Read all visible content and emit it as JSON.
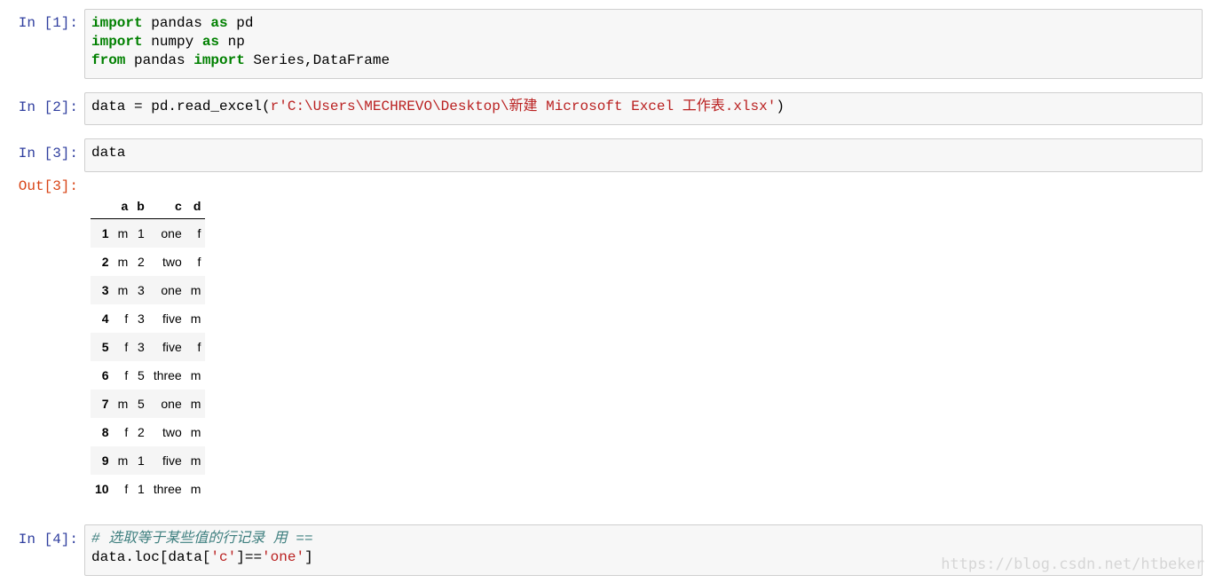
{
  "cells": {
    "c1": {
      "prompt": "In [1]:",
      "lines": [
        [
          {
            "t": "import",
            "c": "kw"
          },
          {
            "t": " pandas ",
            "c": "op"
          },
          {
            "t": "as",
            "c": "kw"
          },
          {
            "t": " pd",
            "c": "op"
          }
        ],
        [
          {
            "t": "import",
            "c": "kw"
          },
          {
            "t": " numpy ",
            "c": "op"
          },
          {
            "t": "as",
            "c": "kw"
          },
          {
            "t": " np",
            "c": "op"
          }
        ],
        [
          {
            "t": "from",
            "c": "kw"
          },
          {
            "t": " pandas ",
            "c": "op"
          },
          {
            "t": "import",
            "c": "kw"
          },
          {
            "t": " Series,DataFrame",
            "c": "op"
          }
        ]
      ]
    },
    "c2": {
      "prompt": "In [2]:",
      "lines": [
        [
          {
            "t": "data = pd.read_excel(",
            "c": "op"
          },
          {
            "t": "r'C:\\Users\\MECHREVO\\Desktop\\新建 Microsoft Excel 工作表.xlsx'",
            "c": "str"
          },
          {
            "t": ")",
            "c": "op"
          }
        ]
      ]
    },
    "c3": {
      "prompt": "In [3]:",
      "out_prompt": "Out[3]:",
      "lines": [
        [
          {
            "t": "data",
            "c": "op"
          }
        ]
      ]
    },
    "c4": {
      "prompt": "In [4]:",
      "lines": [
        [
          {
            "t": "# 选取等于某些值的行记录 用 ==",
            "c": "cmt"
          }
        ],
        [
          {
            "t": "data.loc[data[",
            "c": "op"
          },
          {
            "t": "'c'",
            "c": "str"
          },
          {
            "t": "]==",
            "c": "op"
          },
          {
            "t": "'one'",
            "c": "str"
          },
          {
            "t": "]",
            "c": "op"
          }
        ]
      ]
    }
  },
  "dataframe": {
    "columns": [
      "",
      "a",
      "b",
      "c",
      "d"
    ],
    "rows": [
      [
        "1",
        "m",
        "1",
        "one",
        "f"
      ],
      [
        "2",
        "m",
        "2",
        "two",
        "f"
      ],
      [
        "3",
        "m",
        "3",
        "one",
        "m"
      ],
      [
        "4",
        "f",
        "3",
        "five",
        "m"
      ],
      [
        "5",
        "f",
        "3",
        "five",
        "f"
      ],
      [
        "6",
        "f",
        "5",
        "three",
        "m"
      ],
      [
        "7",
        "m",
        "5",
        "one",
        "m"
      ],
      [
        "8",
        "f",
        "2",
        "two",
        "m"
      ],
      [
        "9",
        "m",
        "1",
        "five",
        "m"
      ],
      [
        "10",
        "f",
        "1",
        "three",
        "m"
      ]
    ]
  },
  "watermark": "https://blog.csdn.net/htbeker",
  "colors": {
    "keyword": "#008000",
    "string": "#ba2121",
    "comment": "#408080",
    "in_prompt": "#303f9f",
    "out_prompt": "#d84315",
    "cell_bg": "#f7f7f7",
    "cell_border": "#cfcfcf"
  }
}
